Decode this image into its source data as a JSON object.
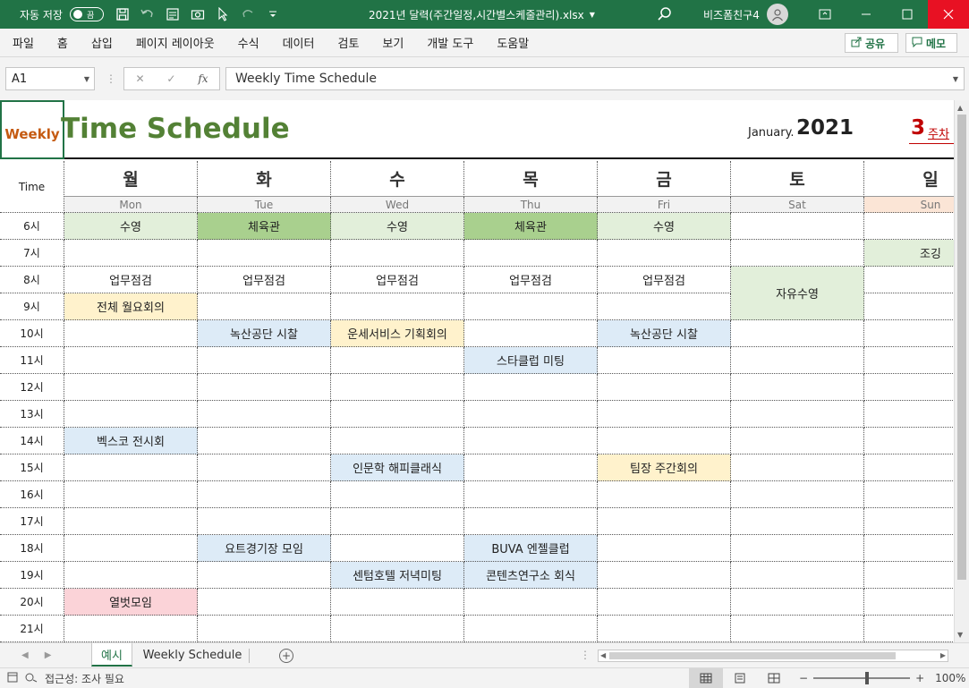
{
  "titlebar": {
    "autosave_label": "자동 저장",
    "autosave_state": "끔",
    "filename": "2021년 달력(주간일정,시간별스케줄관리).xlsx",
    "user": "비즈폼친구4"
  },
  "ribbon": {
    "tabs": [
      "파일",
      "홈",
      "삽입",
      "페이지 레이아웃",
      "수식",
      "데이터",
      "검토",
      "보기",
      "개발 도구",
      "도움말"
    ],
    "share_label": "공유",
    "memo_label": "메모"
  },
  "formula": {
    "cell_ref": "A1",
    "value": "Weekly Time Schedule",
    "fx_label": "fx"
  },
  "sheet": {
    "weekly_label": "Weekly",
    "title": "Time Schedule",
    "month": "January.",
    "year": "2021",
    "week_number": "3",
    "week_suffix": "주차",
    "time_header": "Time",
    "days": [
      {
        "kr": "월",
        "en": "Mon"
      },
      {
        "kr": "화",
        "en": "Tue"
      },
      {
        "kr": "수",
        "en": "Wed"
      },
      {
        "kr": "목",
        "en": "Thu"
      },
      {
        "kr": "금",
        "en": "Fri"
      },
      {
        "kr": "토",
        "en": "Sat"
      },
      {
        "kr": "일",
        "en": "Sun"
      }
    ],
    "hours": [
      "6시",
      "7시",
      "8시",
      "9시",
      "10시",
      "11시",
      "12시",
      "13시",
      "14시",
      "15시",
      "16시",
      "17시",
      "18시",
      "19시",
      "20시",
      "21시"
    ],
    "events": [
      {
        "day": 0,
        "hour": 0,
        "text": "수영",
        "color": "#e2efda"
      },
      {
        "day": 1,
        "hour": 0,
        "text": "체육관",
        "color": "#a9d08e"
      },
      {
        "day": 2,
        "hour": 0,
        "text": "수영",
        "color": "#e2efda"
      },
      {
        "day": 3,
        "hour": 0,
        "text": "체육관",
        "color": "#a9d08e"
      },
      {
        "day": 4,
        "hour": 0,
        "text": "수영",
        "color": "#e2efda"
      },
      {
        "day": 6,
        "hour": 1,
        "text": "조깅",
        "color": "#e2efda"
      },
      {
        "day": 0,
        "hour": 2,
        "text": "업무점검",
        "color": "#ffffff"
      },
      {
        "day": 1,
        "hour": 2,
        "text": "업무점검",
        "color": "#ffffff"
      },
      {
        "day": 2,
        "hour": 2,
        "text": "업무점검",
        "color": "#ffffff"
      },
      {
        "day": 3,
        "hour": 2,
        "text": "업무점검",
        "color": "#ffffff"
      },
      {
        "day": 4,
        "hour": 2,
        "text": "업무점검",
        "color": "#ffffff"
      },
      {
        "day": 5,
        "hour": 2,
        "text": "자유수영",
        "color": "#e2efda",
        "span": 2
      },
      {
        "day": 0,
        "hour": 3,
        "text": "전체 월요회의",
        "color": "#fff2cc"
      },
      {
        "day": 1,
        "hour": 4,
        "text": "녹산공단 시찰",
        "color": "#ddebf7"
      },
      {
        "day": 2,
        "hour": 4,
        "text": "운세서비스 기획회의",
        "color": "#fff2cc"
      },
      {
        "day": 4,
        "hour": 4,
        "text": "녹산공단 시찰",
        "color": "#ddebf7"
      },
      {
        "day": 3,
        "hour": 5,
        "text": "스타클럽 미팅",
        "color": "#ddebf7"
      },
      {
        "day": 0,
        "hour": 8,
        "text": "벡스코 전시회",
        "color": "#ddebf7"
      },
      {
        "day": 2,
        "hour": 9,
        "text": "인문학 해피클래식",
        "color": "#ddebf7"
      },
      {
        "day": 4,
        "hour": 9,
        "text": "팀장 주간회의",
        "color": "#fff2cc"
      },
      {
        "day": 1,
        "hour": 12,
        "text": "요트경기장 모임",
        "color": "#ddebf7"
      },
      {
        "day": 3,
        "hour": 12,
        "text": "BUVA 엔젤클럽",
        "color": "#ddebf7"
      },
      {
        "day": 2,
        "hour": 13,
        "text": "센텀호텔 저녁미팅",
        "color": "#ddebf7"
      },
      {
        "day": 3,
        "hour": 13,
        "text": "콘텐츠연구소 회식",
        "color": "#ddebf7"
      },
      {
        "day": 0,
        "hour": 14,
        "text": "열벗모임",
        "color": "#fbd3d8"
      }
    ]
  },
  "tabs": {
    "active": "예시",
    "other": "Weekly Schedule"
  },
  "status": {
    "accessibility": "접근성: 조사 필요",
    "zoom": "100%"
  },
  "colors": {
    "brand": "#217346",
    "title_green": "#538135",
    "weekly_orange": "#c55a11",
    "week_red": "#c00000"
  }
}
